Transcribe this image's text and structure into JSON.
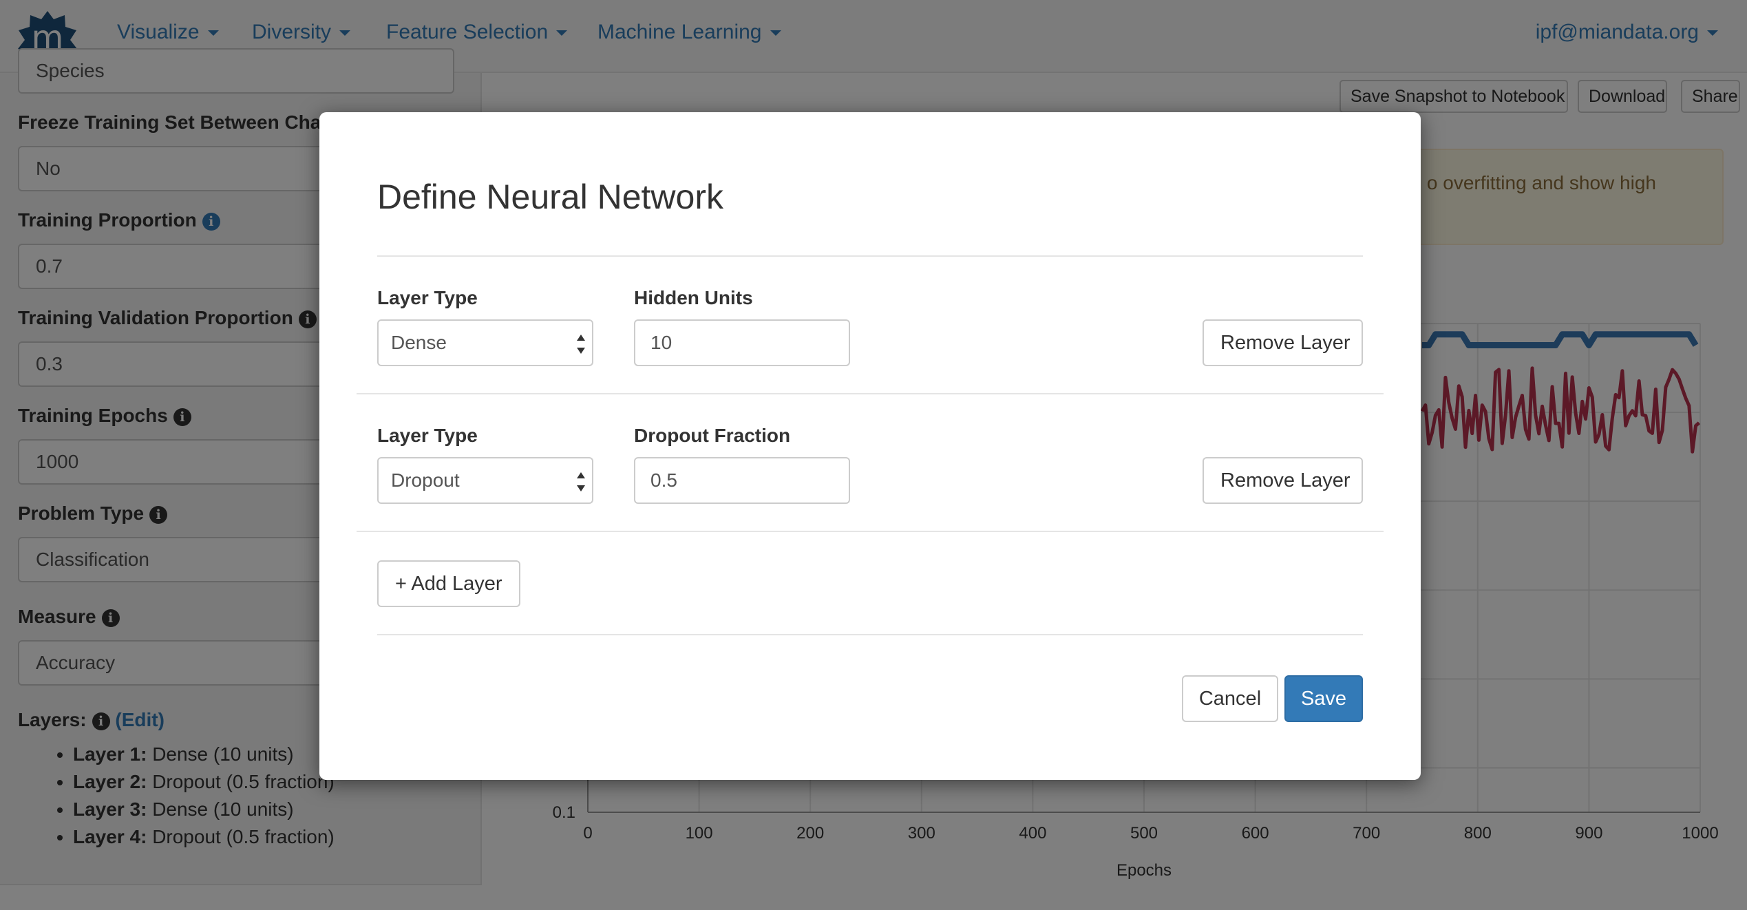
{
  "navbar": {
    "logo_letter": "m",
    "items": [
      {
        "label": "Visualize"
      },
      {
        "label": "Diversity"
      },
      {
        "label": "Feature Selection"
      },
      {
        "label": "Machine Learning"
      }
    ],
    "user": "ipf@miandata.org"
  },
  "sidebar": {
    "top_select_value": "Species",
    "freeze_label": "Freeze Training Set Between Changes",
    "freeze_value": "No",
    "training_proportion_label": "Training Proportion",
    "training_proportion_value": "0.7",
    "validation_proportion_label": "Training Validation Proportion",
    "validation_proportion_value": "0.3",
    "epochs_label": "Training Epochs",
    "epochs_value": "1000",
    "problem_type_label": "Problem Type",
    "problem_type_value": "Classification",
    "measure_label": "Measure",
    "measure_value": "Accuracy",
    "layers_label": "Layers:",
    "layers_edit": "(Edit)",
    "layers": [
      {
        "name": "Layer 1:",
        "desc": "Dense (10 units)"
      },
      {
        "name": "Layer 2:",
        "desc": "Dropout (0.5 fraction)"
      },
      {
        "name": "Layer 3:",
        "desc": "Dense (10 units)"
      },
      {
        "name": "Layer 4:",
        "desc": "Dropout (0.5 fraction)"
      }
    ]
  },
  "main": {
    "save_snapshot": "Save Snapshot to Notebook",
    "download": "Download",
    "share": "Share",
    "alert_text": "o overfitting and show high"
  },
  "chart_data": {
    "type": "line",
    "xlabel": "Epochs",
    "x_ticks": [
      "0",
      "100",
      "200",
      "300",
      "400",
      "500",
      "600",
      "700",
      "800",
      "900",
      "1000"
    ],
    "y_ticks_visible": [
      "0.1"
    ],
    "xlim": [
      0,
      1000
    ],
    "ylim": [
      0.1,
      1.0
    ],
    "series": [
      {
        "color": "#3a78b5",
        "approx_level": 0.96,
        "visible_x_range": [
          750,
          1000
        ]
      },
      {
        "color": "#b8334f",
        "approx_range": [
          0.76,
          0.92
        ],
        "visible_x_range": [
          750,
          1000
        ]
      }
    ]
  },
  "modal": {
    "title": "Define Neural Network",
    "layers": [
      {
        "type_label": "Layer Type",
        "type_value": "Dense",
        "param_label": "Hidden Units",
        "param_value": "10",
        "remove_label": "Remove Layer"
      },
      {
        "type_label": "Layer Type",
        "type_value": "Dropout",
        "param_label": "Dropout Fraction",
        "param_value": "0.5",
        "remove_label": "Remove Layer"
      }
    ],
    "add_layer": "+ Add Layer",
    "cancel": "Cancel",
    "save": "Save"
  },
  "colors": {
    "link": "#337ab7",
    "primary_button": "#337ab7",
    "series_blue": "#3a78b5",
    "series_red": "#b8334f",
    "logo": "#1f4e79"
  }
}
